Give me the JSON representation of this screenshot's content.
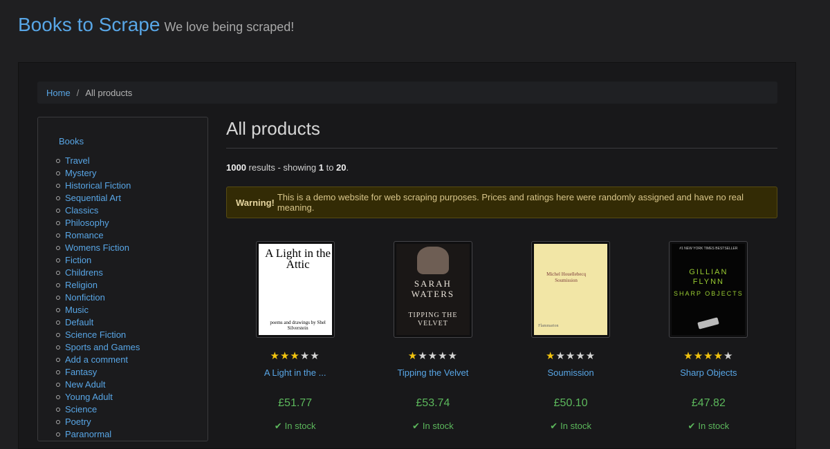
{
  "header": {
    "title": "Books to Scrape",
    "tagline": "We love being scraped!"
  },
  "breadcrumb": {
    "home": "Home",
    "separator": "/",
    "current": "All products"
  },
  "sidebar": {
    "top_link": "Books",
    "categories": [
      "Travel",
      "Mystery",
      "Historical Fiction",
      "Sequential Art",
      "Classics",
      "Philosophy",
      "Romance",
      "Womens Fiction",
      "Fiction",
      "Childrens",
      "Religion",
      "Nonfiction",
      "Music",
      "Default",
      "Science Fiction",
      "Sports and Games",
      "Add a comment",
      "Fantasy",
      "New Adult",
      "Young Adult",
      "Science",
      "Poetry",
      "Paranormal"
    ]
  },
  "main": {
    "title": "All products",
    "results_count": "1000",
    "results_mid": "results - showing",
    "results_from": "1",
    "results_to_word": "to",
    "results_to": "20",
    "results_end": ".",
    "warning_strong": "Warning!",
    "warning_text": "This is a demo website for web scraping purposes. Prices and ratings here were randomly assigned and have no real meaning."
  },
  "products": [
    {
      "title": "A Light in the ...",
      "price": "£51.77",
      "rating": 3,
      "stock": "In stock",
      "cover_title": "A Light in the Attic",
      "cover_sub": "poems and drawings by Shel Silverstein"
    },
    {
      "title": "Tipping the Velvet",
      "price": "£53.74",
      "rating": 1,
      "stock": "In stock",
      "cover_author": "SARAH WATERS",
      "cover_title": "TIPPING THE VELVET"
    },
    {
      "title": "Soumission",
      "price": "£50.10",
      "rating": 1,
      "stock": "In stock",
      "cover_author": "Michel Houellebecq",
      "cover_title": "Soumission",
      "cover_publisher": "Flammarion"
    },
    {
      "title": "Sharp Objects",
      "price": "£47.82",
      "rating": 4,
      "stock": "In stock",
      "cover_top": "#1 NEW YORK TIMES BESTSELLER",
      "cover_author": "GILLIAN FLYNN",
      "cover_title": "SHARP OBJECTS"
    }
  ],
  "colors": {
    "link": "#58a6e6",
    "price": "#5cb85c",
    "star": "#f2c40f",
    "warning_bg": "#332b05"
  }
}
